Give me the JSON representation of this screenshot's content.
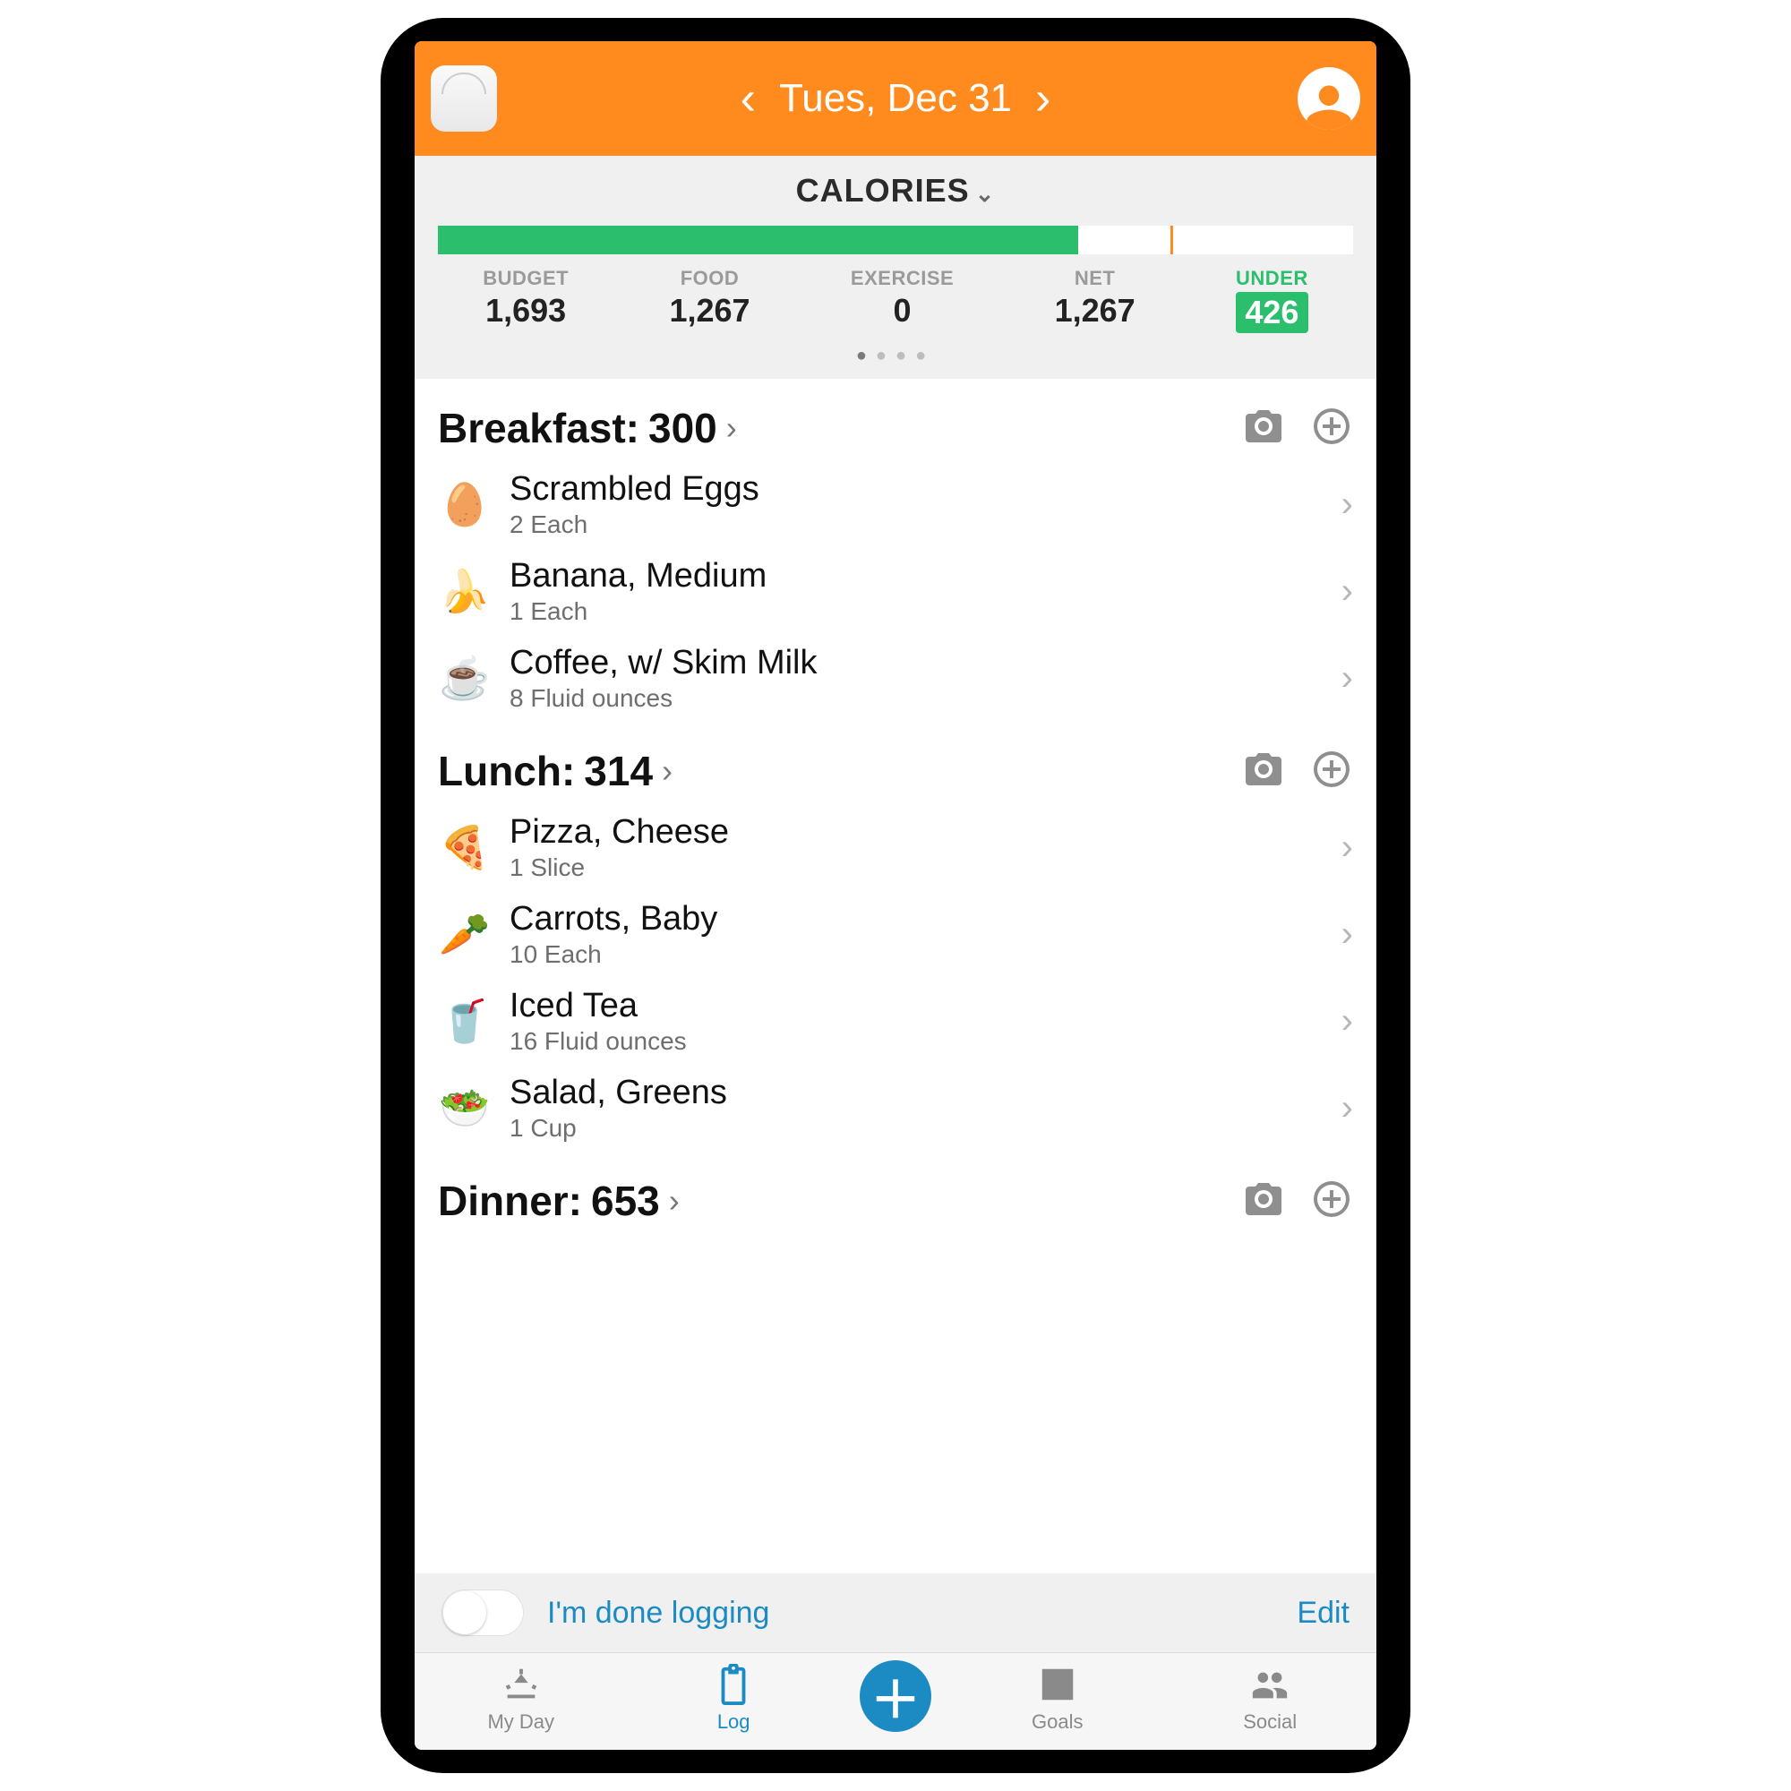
{
  "header": {
    "date_label": "Tues, Dec 31"
  },
  "summary": {
    "title": "CALORIES",
    "budget_label": "BUDGET",
    "budget_value": "1,693",
    "food_label": "FOOD",
    "food_value": "1,267",
    "exercise_label": "EXERCISE",
    "exercise_value": "0",
    "net_label": "NET",
    "net_value": "1,267",
    "under_label": "UNDER",
    "under_value": "426"
  },
  "meals": [
    {
      "title": "Breakfast:",
      "calories": "300",
      "items": [
        {
          "icon": "🥚",
          "name": "Scrambled Eggs",
          "qty": "2 Each"
        },
        {
          "icon": "🍌",
          "name": "Banana, Medium",
          "qty": "1 Each"
        },
        {
          "icon": "☕",
          "name": "Coffee, w/ Skim Milk",
          "qty": "8 Fluid ounces"
        }
      ]
    },
    {
      "title": "Lunch:",
      "calories": "314",
      "items": [
        {
          "icon": "🍕",
          "name": "Pizza, Cheese",
          "qty": "1 Slice"
        },
        {
          "icon": "🥕",
          "name": "Carrots, Baby",
          "qty": "10 Each"
        },
        {
          "icon": "🥤",
          "name": "Iced Tea",
          "qty": "16 Fluid ounces"
        },
        {
          "icon": "🥗",
          "name": "Salad, Greens",
          "qty": "1 Cup"
        }
      ]
    },
    {
      "title": "Dinner:",
      "calories": "653",
      "items": []
    }
  ],
  "done_bar": {
    "text": "I'm done logging",
    "edit": "Edit"
  },
  "tabs": {
    "myday": "My Day",
    "log": "Log",
    "goals": "Goals",
    "social": "Social"
  }
}
